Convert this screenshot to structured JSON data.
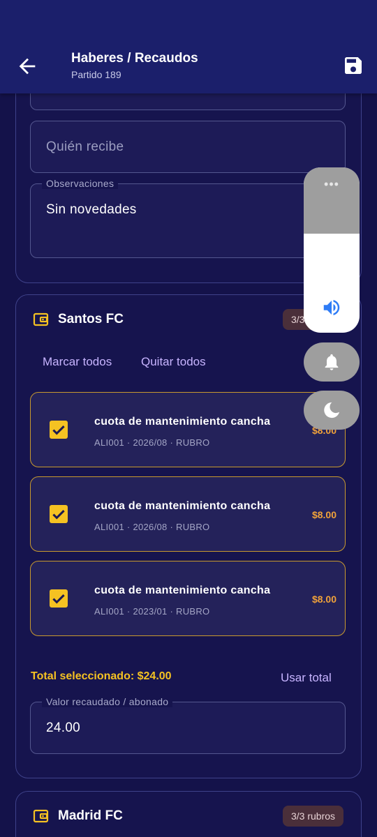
{
  "header": {
    "title": "Haberes / Recaudos",
    "subtitle": "Partido 189"
  },
  "form": {
    "receiver_placeholder": "Quién recibe",
    "observations_label": "Observaciones",
    "observations_value": "Sin novedades"
  },
  "groups": [
    {
      "name": "Santos FC",
      "badge": "3/3 rubros",
      "select_all_label": "Marcar todos",
      "clear_all_label": "Quitar todos",
      "items": [
        {
          "title": "cuota de mantenimiento cancha",
          "detail": "ALI001 · 2026/08 · RUBRO",
          "amount": "$8.00",
          "checked": true
        },
        {
          "title": "cuota de mantenimiento cancha",
          "detail": "ALI001 · 2026/08 · RUBRO",
          "amount": "$8.00",
          "checked": true
        },
        {
          "title": "cuota de mantenimiento cancha",
          "detail": "ALI001 · 2023/01 · RUBRO",
          "amount": "$8.00",
          "checked": true
        }
      ],
      "total_label": "Total seleccionado: $24.00",
      "use_total_label": "Usar total",
      "amount_field_label": "Valor recaudado / abonado",
      "amount_field_value": "24.00"
    },
    {
      "name": "Madrid FC",
      "badge": "3/3 rubros"
    }
  ],
  "volume_overlay": {
    "more_label": "•••",
    "level_percent": 60,
    "icons": [
      "speaker-icon",
      "bell-icon",
      "moon-icon"
    ]
  },
  "colors": {
    "background": "#14124a",
    "appbar": "#1b1f6b",
    "accent_yellow": "#f5c222",
    "amount_orange": "#f0a23a",
    "link_purple": "#c7b4ff",
    "item_border": "#c99a2e"
  }
}
